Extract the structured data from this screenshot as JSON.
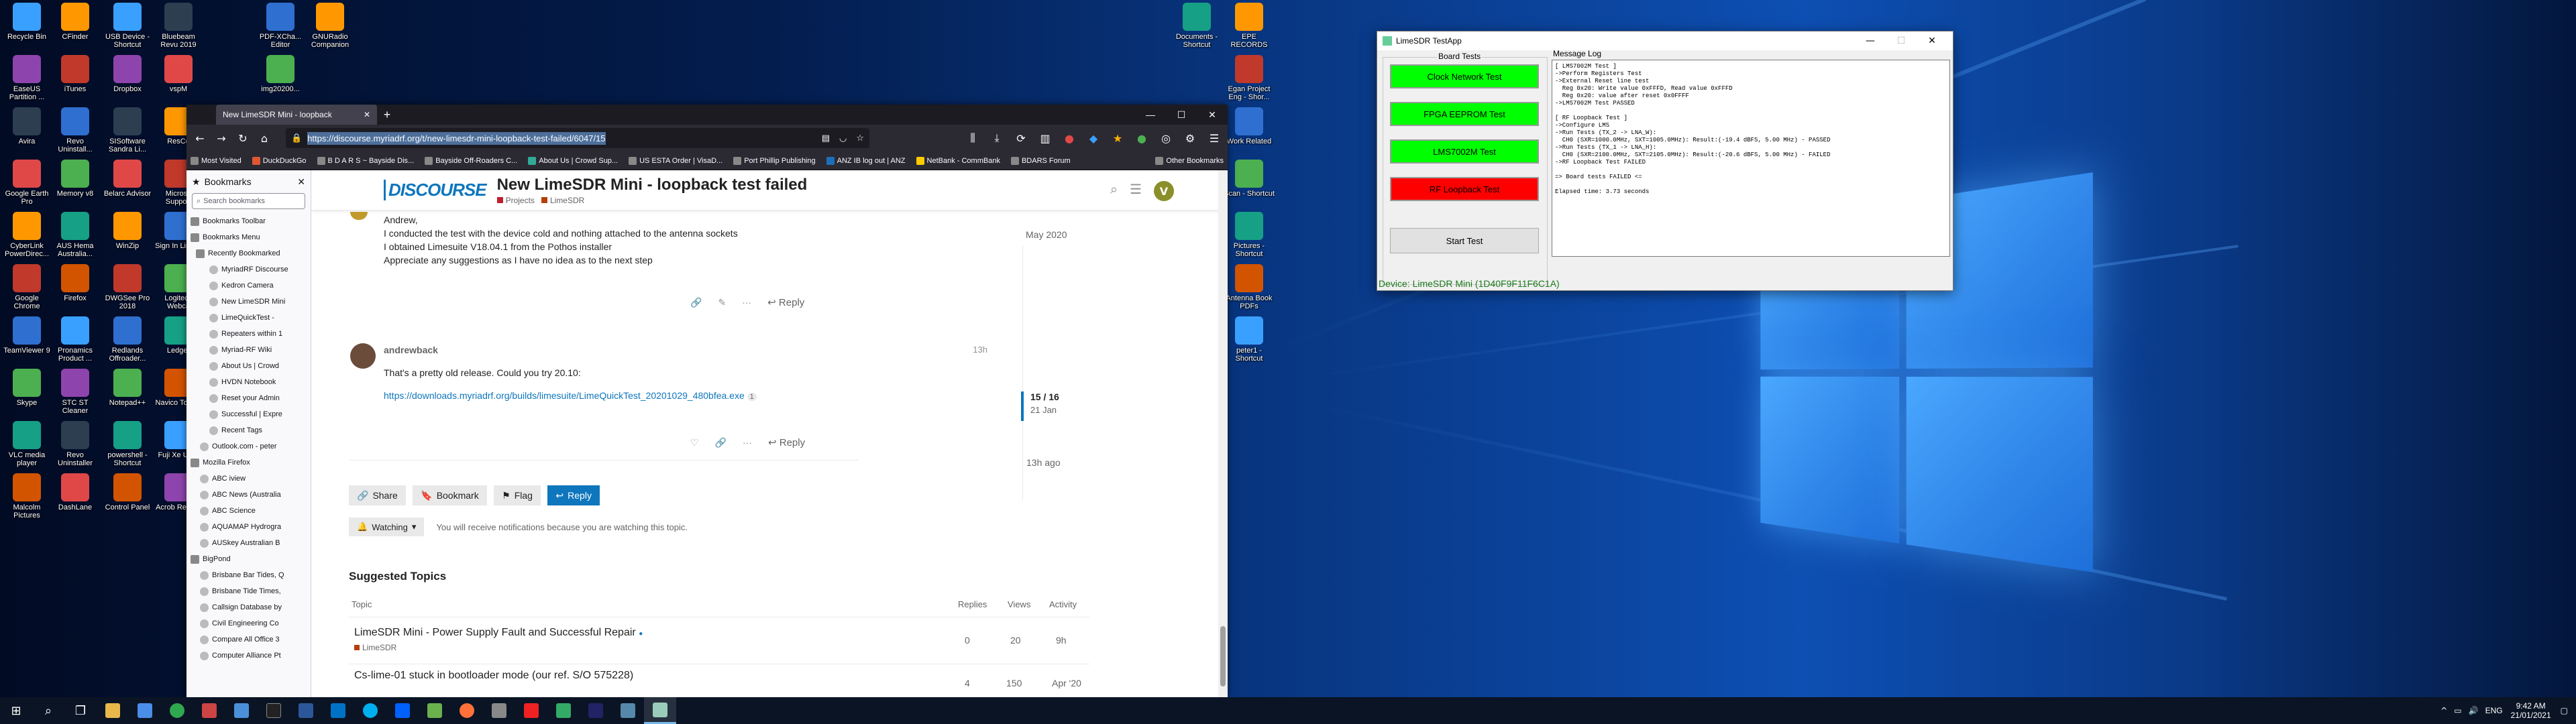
{
  "desktop": {
    "icons_col1": [
      "Recycle Bin",
      "EaseUS Partition ...",
      "Avira",
      "Google Earth Pro",
      "CyberLink PowerDirec...",
      "Google Chrome",
      "TeamViewer 9",
      "Skype",
      "VLC media player",
      "Malcolm Pictures"
    ],
    "icons_col2": [
      "CFinder",
      "iTunes",
      "Revo Uninstall...",
      "Memory v8",
      "AUS Hema Australia...",
      "Firefox",
      "Pronamics Product ...",
      "STC ST Cleaner",
      "Revo Uninstaller",
      "DashLane"
    ],
    "icons_col3": [
      "USB Device - Shortcut",
      "Dropbox",
      "SISoftware Sandra Li...",
      "Belarc Advisor",
      "WinZip",
      "DWGSee Pro 2018",
      "Redlands Offroader...",
      "Notepad++",
      "powershell - Shortcut",
      "Control Panel"
    ],
    "icons_col4": [
      "Bluebeam Revu 2019",
      "vspM",
      "ResCo",
      "Microso Support",
      "Sign In Linked",
      "Logitech Webca",
      "Ledger",
      "Navico Toolbo",
      "Fuji Xe Utiliti",
      "Acrob Reader"
    ],
    "icons_col5": [
      "PDF-XCha... Editor",
      "img20200..."
    ],
    "icons_col6": [
      "GNURadio Companion"
    ],
    "icons_right1": [
      "Documents - Shortcut"
    ],
    "icons_right2": [
      "EPE RECORDS",
      "Egan Project Eng - Shor...",
      "Work Related",
      "Scan - Shortcut",
      "Pictures - Shortcut",
      "Antenna Book PDFs",
      "peter1 - Shortcut"
    ]
  },
  "browser": {
    "tab_title": "New LimeSDR Mini - loopback",
    "url": "https://discourse.myriadrf.org/t/new-limesdr-mini-loopback-test-failed/6047/15",
    "bookmarks_bar": [
      "Most Visited",
      "DuckDuckGo",
      "B D A R S ~ Bayside Dis...",
      "Bayside Off-Roaders C...",
      "About Us | Crowd Sup...",
      "US ESTA Order | VisaD...",
      "Port Phillip Publishing",
      "ANZ IB log out | ANZ",
      "NetBank - CommBank",
      "BDARS Forum",
      "Other Bookmarks"
    ],
    "sidebar": {
      "title": "Bookmarks",
      "search_placeholder": "Search bookmarks",
      "items": [
        "Bookmarks Toolbar",
        "Bookmarks Menu",
        "Recently Bookmarked",
        "MyriadRF Discourse",
        "Kedron Camera",
        "New LimeSDR Mini",
        "LimeQuickTest - ",
        "Repeaters within 1",
        "Myriad-RF Wiki",
        "About Us | Crowd",
        "HVDN Notebook",
        "Reset your Admin",
        "Successful | Expre",
        "Recent Tags",
        "Outlook.com - peter",
        "Mozilla Firefox",
        "ABC iview",
        "ABC News (Australia",
        "ABC Science",
        "AQUAMAP Hydrogra",
        "AUSkey  Australian B",
        "BigPond",
        "Brisbane Bar Tides, Q",
        "Brisbane Tide Times,",
        "Callsign Database by",
        "Civil Engineering Co",
        "Compare All Office 3",
        "Computer Alliance Pt"
      ]
    },
    "discourse": {
      "logo": "DISCOURSE",
      "topic_title": "New LimeSDR Mini - loopback test failed",
      "category_projects": "Projects",
      "category_limesdr": "LimeSDR",
      "avatar_letter": "V",
      "post1": {
        "greeting": "Andrew,",
        "line1": "I conducted the test with the device cold and nothing attached to the antenna sockets",
        "line2": "I obtained Limesuite V18.04.1 from the Pothos installer",
        "line3": "Appreciate any suggestions as I have no idea as to the next step",
        "reply": "Reply"
      },
      "post2": {
        "username": "andrewback",
        "age": "13h",
        "text": "That's a pretty old release. Could you try 20.10:",
        "link": "https://downloads.myriadrf.org/builds/limesuite/LimeQuickTest_20201029_480bfea.exe",
        "link_count": "1",
        "reply": "Reply"
      },
      "timeline": {
        "top_date": "May 2020",
        "counter": "15 / 16",
        "date": "21 Jan",
        "bottom": "13h ago"
      },
      "buttons": {
        "share": "Share",
        "bookmark": "Bookmark",
        "flag": "Flag",
        "reply": "Reply"
      },
      "watching": {
        "label": "Watching",
        "note": "You will receive notifications because you are watching this topic."
      },
      "suggested": {
        "heading": "Suggested Topics",
        "columns": [
          "Topic",
          "Replies",
          "Views",
          "Activity"
        ],
        "rows": [
          {
            "title": "LimeSDR Mini - Power Supply Fault and Successful Repair",
            "category": "LimeSDR",
            "replies": "0",
            "views": "20",
            "activity": "9h"
          },
          {
            "title": "Cs-lime-01 stuck in bootloader mode (our ref. S/O 575228)",
            "category": "",
            "replies": "4",
            "views": "150",
            "activity": "Apr '20"
          }
        ]
      }
    }
  },
  "limeapp": {
    "title": "LimeSDR TestApp",
    "board_tests_label": "Board Tests",
    "message_log_label": "Message Log",
    "tests": [
      {
        "label": "Clock Network Test",
        "color": "#00ff00"
      },
      {
        "label": "FPGA EEPROM Test",
        "color": "#00ff00"
      },
      {
        "label": "LMS7002M Test",
        "color": "#00ff00"
      },
      {
        "label": "RF Loopback Test",
        "color": "#ff0000"
      }
    ],
    "start_button": "Start Test",
    "log": "[ LMS7002M Test ]\n->Perform Registers Test\n->External Reset line test\n  Reg 0x20: Write value 0xFFFD, Read value 0xFFFD\n  Reg 0x20: value after reset 0x0FFFF\n->LMS7002M Test PASSED\n\n[ RF Loopback Test ]\n->Configure LMS\n->Run Tests (TX_2 -> LNA_W):\n  CH0 (SXR=1000.0MHz, SXT=1005.0MHz): Result:(-19.4 dBFS, 5.00 MHz) - PASSED\n->Run Tests (TX_1 -> LNA_H):\n  CH0 (SXR=2100.0MHz, SXT=2105.0MHz): Result:(-20.6 dBFS, 5.00 MHz) - FAILED\n->RF Loopback Test FAILED\n\n=> Board tests FAILED <=\n\nElapsed time: 3.73 seconds",
    "device": "Device: LimeSDR Mini (1D40F9F11F6C1A)"
  },
  "taskbar": {
    "time": "9:42 AM",
    "date": "21/01/2021",
    "lang": "ENG"
  }
}
